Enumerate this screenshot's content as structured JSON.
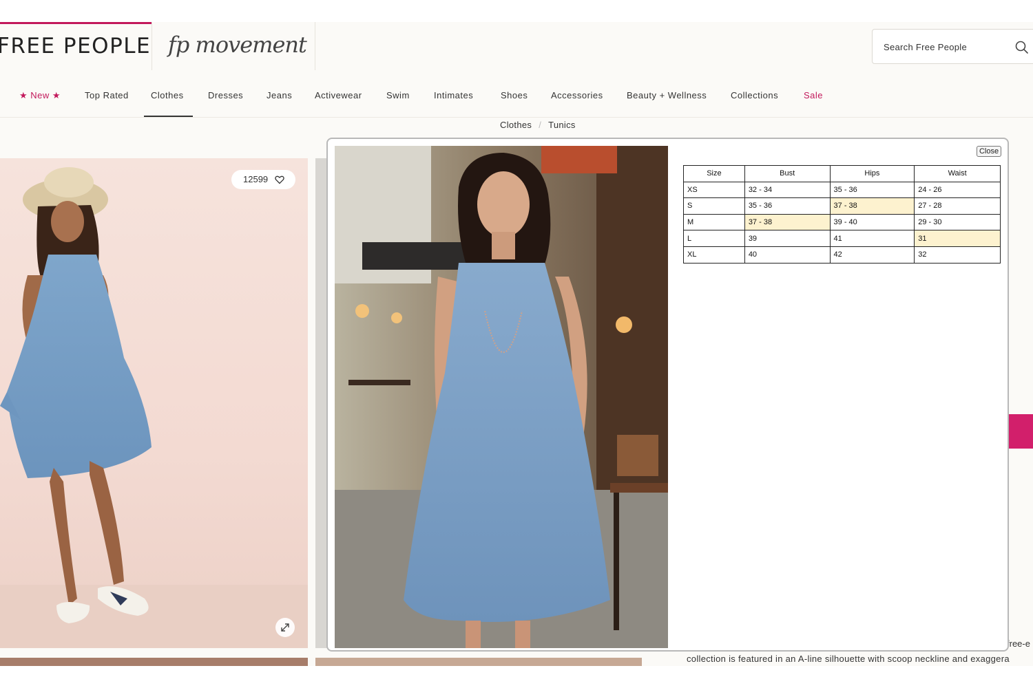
{
  "header": {
    "brand": "FREE PEOPLE",
    "sub_brand": "fp movement",
    "search_placeholder": "Search Free People"
  },
  "nav": {
    "items": [
      {
        "label": "New",
        "key": "new"
      },
      {
        "label": "Top Rated",
        "key": "top-rated"
      },
      {
        "label": "Clothes",
        "key": "clothes"
      },
      {
        "label": "Dresses",
        "key": "dresses"
      },
      {
        "label": "Jeans",
        "key": "jeans"
      },
      {
        "label": "Activewear",
        "key": "activewear"
      },
      {
        "label": "Swim",
        "key": "swim"
      },
      {
        "label": "Intimates",
        "key": "intimates"
      },
      {
        "label": "Shoes",
        "key": "shoes"
      },
      {
        "label": "Accessories",
        "key": "accessories"
      },
      {
        "label": "Beauty + Wellness",
        "key": "beauty-wellness"
      },
      {
        "label": "Collections",
        "key": "collections"
      },
      {
        "label": "Sale",
        "key": "sale"
      }
    ],
    "active": "Clothes",
    "sale_color": "#c2185b"
  },
  "breadcrumb": [
    "Clothes",
    "Tunics"
  ],
  "product": {
    "likes": "12599",
    "description_fragment": "free-e",
    "description_line": "collection is featured in an A-line silhouette with scoop neckline and exaggera"
  },
  "size_chart": {
    "close_label": "Close",
    "columns": [
      "Size",
      "Bust",
      "Hips",
      "Waist"
    ],
    "rows": [
      {
        "size": "XS",
        "bust": "32 - 34",
        "hips": "35 - 36",
        "waist": "24 - 26"
      },
      {
        "size": "S",
        "bust": "35 - 36",
        "hips": "37 - 38",
        "waist": "27 - 28"
      },
      {
        "size": "M",
        "bust": "37 - 38",
        "hips": "39 - 40",
        "waist": "29 - 30"
      },
      {
        "size": "L",
        "bust": "39",
        "hips": "41",
        "waist": "31"
      },
      {
        "size": "XL",
        "bust": "40",
        "hips": "42",
        "waist": "32"
      }
    ],
    "highlight_color": "#fdf2cf"
  },
  "colors": {
    "brand_accent": "#c2185b",
    "button_pink": "#d21f6b",
    "dress_blue": "#7fa4c9"
  },
  "icons": {
    "search": "search-icon",
    "heart": "heart-icon",
    "expand": "expand-icon",
    "star": "star-icon"
  }
}
